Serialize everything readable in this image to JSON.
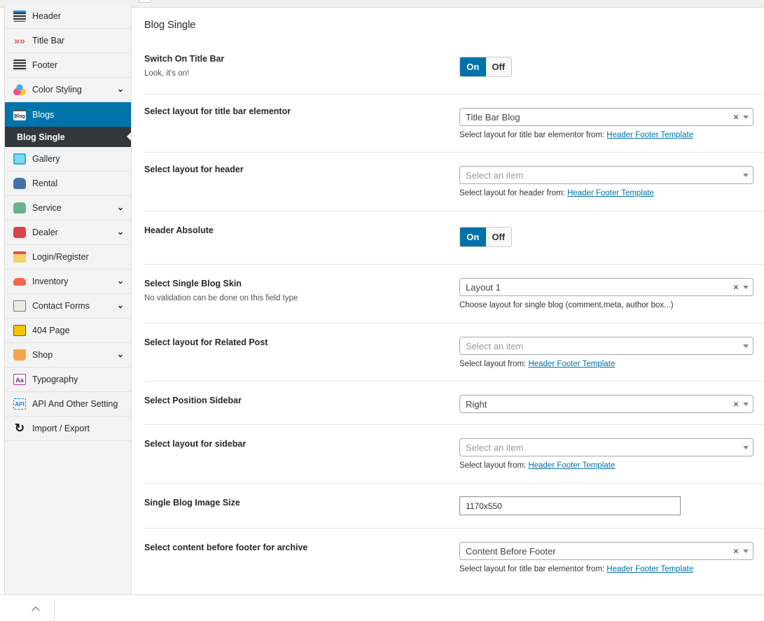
{
  "sidebar": {
    "items": [
      {
        "label": "Header",
        "icon": "header-icon",
        "chev": false
      },
      {
        "label": "Title Bar",
        "icon": "title-bar-icon",
        "chev": false
      },
      {
        "label": "Footer",
        "icon": "footer-icon",
        "chev": false
      },
      {
        "label": "Color Styling",
        "icon": "color-styling-icon",
        "chev": true
      },
      {
        "label": "Blogs",
        "icon": "blogs-icon",
        "chev": false,
        "active": true
      },
      {
        "label": "Gallery",
        "icon": "gallery-icon",
        "chev": false
      },
      {
        "label": "Rental",
        "icon": "rental-icon",
        "chev": false
      },
      {
        "label": "Service",
        "icon": "service-icon",
        "chev": true
      },
      {
        "label": "Dealer",
        "icon": "dealer-icon",
        "chev": true
      },
      {
        "label": "Login/Register",
        "icon": "login-icon",
        "chev": false
      },
      {
        "label": "Inventory",
        "icon": "inventory-icon",
        "chev": true
      },
      {
        "label": "Contact Forms",
        "icon": "contact-forms-icon",
        "chev": true
      },
      {
        "label": "404 Page",
        "icon": "404-page-icon",
        "chev": false
      },
      {
        "label": "Shop",
        "icon": "shop-icon",
        "chev": true
      },
      {
        "label": "Typography",
        "icon": "typography-icon",
        "chev": false
      },
      {
        "label": "API And Other Setting",
        "icon": "api-icon",
        "chev": false
      },
      {
        "label": "Import / Export",
        "icon": "refresh-icon",
        "chev": false
      }
    ],
    "sub_active": "Blog Single",
    "blogs_icon_text": "Blog",
    "api_icon_text": "API",
    "typo_icon_text": "Aa"
  },
  "main": {
    "title": "Blog Single",
    "toggle": {
      "on": "On",
      "off": "Off"
    },
    "link": "Header Footer Template",
    "rows": [
      {
        "label": "Switch On Title Bar",
        "desc": "Look, it's on!"
      },
      {
        "label": "Select layout for title bar elementor",
        "value": "Title Bar Blog",
        "help": "Select layout for title bar elementor from: "
      },
      {
        "label": "Select layout for header",
        "value": "Select an item",
        "help": "Select layout for header from: "
      },
      {
        "label": "Header Absolute"
      },
      {
        "label": "Select Single Blog Skin",
        "desc": "No validation can be done on this field type",
        "value": "Layout 1",
        "help": "Choose layout for single blog (comment,meta, author box...)"
      },
      {
        "label": "Select layout for Related Post",
        "value": "Select an item",
        "help": "Select layout from: "
      },
      {
        "label": "Select Position Sidebar",
        "value": "Right"
      },
      {
        "label": "Select layout for sidebar",
        "value": "Select an item",
        "help": "Select layout from: "
      },
      {
        "label": "Single Blog Image Size",
        "value": "1170x550"
      },
      {
        "label": "Select content before footer for archive",
        "value": "Content Before Footer",
        "help": "Select layout for title bar elementor from: "
      }
    ]
  }
}
